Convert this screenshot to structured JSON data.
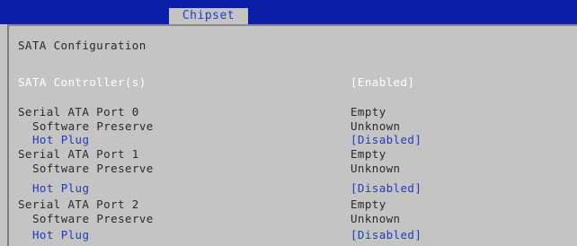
{
  "header": {
    "tab_label": "Chipset"
  },
  "main": {
    "section_title": "SATA Configuration",
    "controller": {
      "label": "SATA Controller(s)",
      "value": "[Enabled]"
    },
    "ports": [
      {
        "label": "Serial ATA Port 0",
        "status": "Empty",
        "software_preserve_label": "Software Preserve",
        "software_preserve_value": "Unknown",
        "hot_plug_label": "Hot Plug",
        "hot_plug_value": "[Disabled]"
      },
      {
        "label": "Serial ATA Port 1",
        "status": "Empty",
        "software_preserve_label": "Software Preserve",
        "software_preserve_value": "Unknown",
        "hot_plug_label": "Hot Plug",
        "hot_plug_value": "[Disabled]"
      },
      {
        "label": "Serial ATA Port 2",
        "status": "Empty",
        "software_preserve_label": "Software Preserve",
        "software_preserve_value": "Unknown",
        "hot_plug_label": "Hot Plug",
        "hot_plug_value": "[Disabled]"
      }
    ]
  },
  "colors": {
    "header_bar": "#0b1fa8",
    "background": "#c4c4c4",
    "selectable_text": "#1f3bc4",
    "highlighted_text": "#ffffff",
    "static_text": "#2a2a2a"
  }
}
